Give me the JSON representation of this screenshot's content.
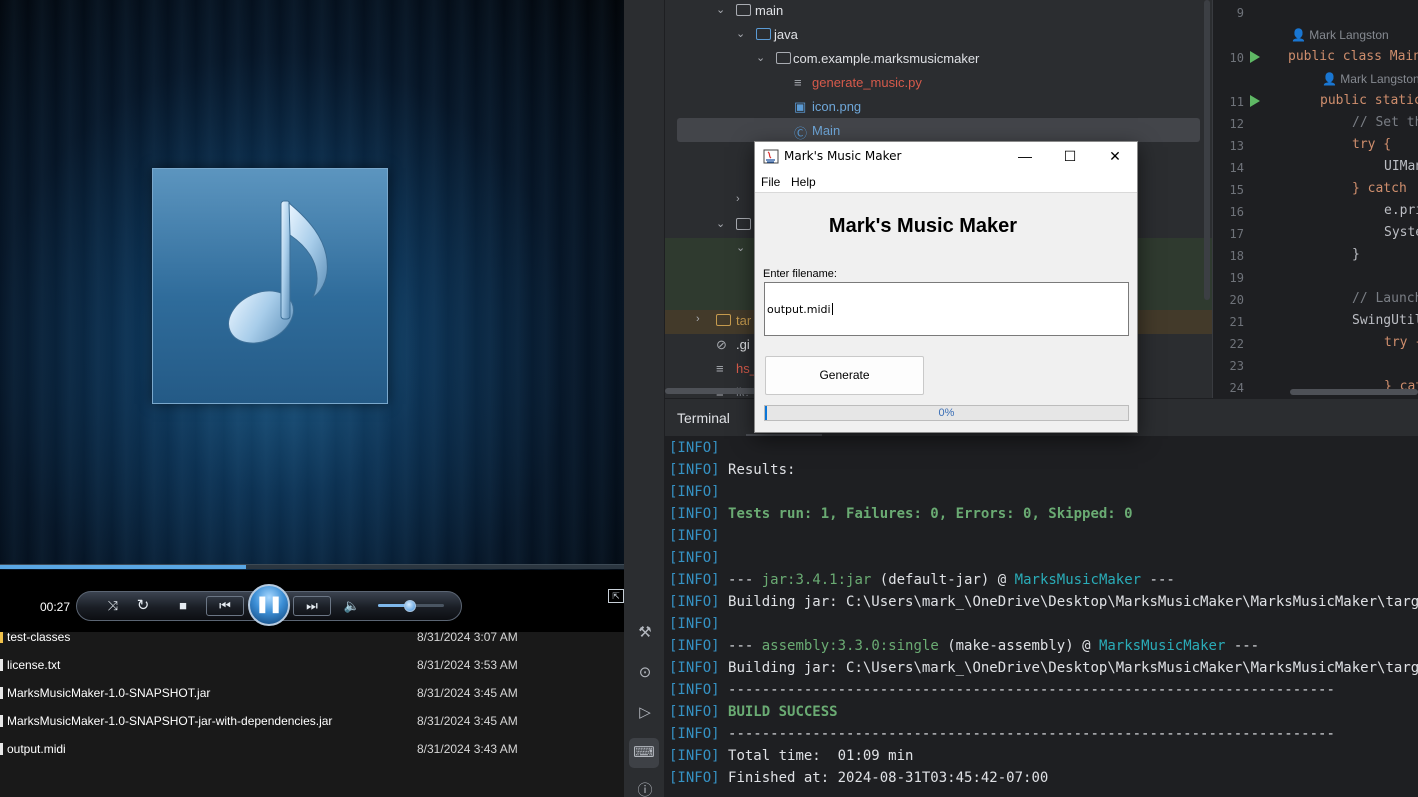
{
  "media_player": {
    "elapsed": "00:27",
    "progress_fraction": 0.395,
    "volume_fraction": 0.5,
    "buttons": {
      "shuffle": "⤨",
      "repeat": "↻",
      "stop": "■",
      "previous": "⏮",
      "play_pause": "❚❚",
      "next": "⏭",
      "mute": "🔈",
      "switch_mode": "⇱"
    }
  },
  "file_list": [
    {
      "name": "test-classes",
      "date": "8/31/2024 3:07 AM"
    },
    {
      "name": "license.txt",
      "date": "8/31/2024 3:53 AM"
    },
    {
      "name": "MarksMusicMaker-1.0-SNAPSHOT.jar",
      "date": "8/31/2024 3:45 AM"
    },
    {
      "name": "MarksMusicMaker-1.0-SNAPSHOT-jar-with-dependencies.jar",
      "date": "8/31/2024 3:45 AM"
    },
    {
      "name": "output.midi",
      "date": "8/31/2024 3:43 AM"
    }
  ],
  "project_tree": {
    "main": "main",
    "java": "java",
    "package": "com.example.marksmusicmaker",
    "file_py": "generate_music.py",
    "file_icon": "icon.png",
    "file_main": "Main",
    "partial_target": "tar",
    "partial_git": ".gi",
    "partial_hs": "hs_",
    "partial_lic": "lic"
  },
  "editor": {
    "line_numbers": [
      "9",
      "10",
      "11",
      "12",
      "13",
      "14",
      "15",
      "16",
      "17",
      "18",
      "19",
      "20",
      "21",
      "22",
      "23",
      "24"
    ],
    "author": "Mark Langston",
    "lines": {
      "l10": "public class Main",
      "l11": "public static",
      "l12": "// Set th",
      "l13": "try {",
      "l14": "UIMan",
      "l15": "} catch",
      "l16": "e.pri",
      "l17": "Syste",
      "l18": "}",
      "l20": "// Launch",
      "l21": "SwingUtil",
      "l22": "try {",
      "l24": "} cat"
    }
  },
  "terminal": {
    "tab": "Terminal",
    "info_tag": "[INFO]",
    "results": "Results:",
    "tests": "Tests run: 1, Failures: 0, Errors: 0, Skipped: 0",
    "jar_plugin": "jar:3.4.1:jar",
    "jar_exec": "(default-jar)",
    "at": "@",
    "project": "MarksMusicMaker",
    "dashes3": "---",
    "building_jar": "Building jar: C:\\Users\\mark_\\OneDrive\\Desktop\\MarksMusicMaker\\MarksMusicMaker\\target\\Ma",
    "assembly_plugin": "assembly:3.3.0:single",
    "assembly_exec": "(make-assembly)",
    "separator": "------------------------------------------------------------------------",
    "build_success": "BUILD SUCCESS",
    "total_time": "Total time:  01:09 min",
    "finished_at": "Finished at: 2024-08-31T03:45:42-07:00"
  },
  "dialog": {
    "title": "Mark's Music Maker",
    "menu_file": "File",
    "menu_help": "Help",
    "heading": "Mark's Music Maker",
    "label": "Enter filename:",
    "input_value": "output.midi",
    "button": "Generate",
    "progress_fraction": 0.0,
    "progress_text": "0%",
    "minimize": "—",
    "maximize": "☐",
    "close": "✕"
  }
}
